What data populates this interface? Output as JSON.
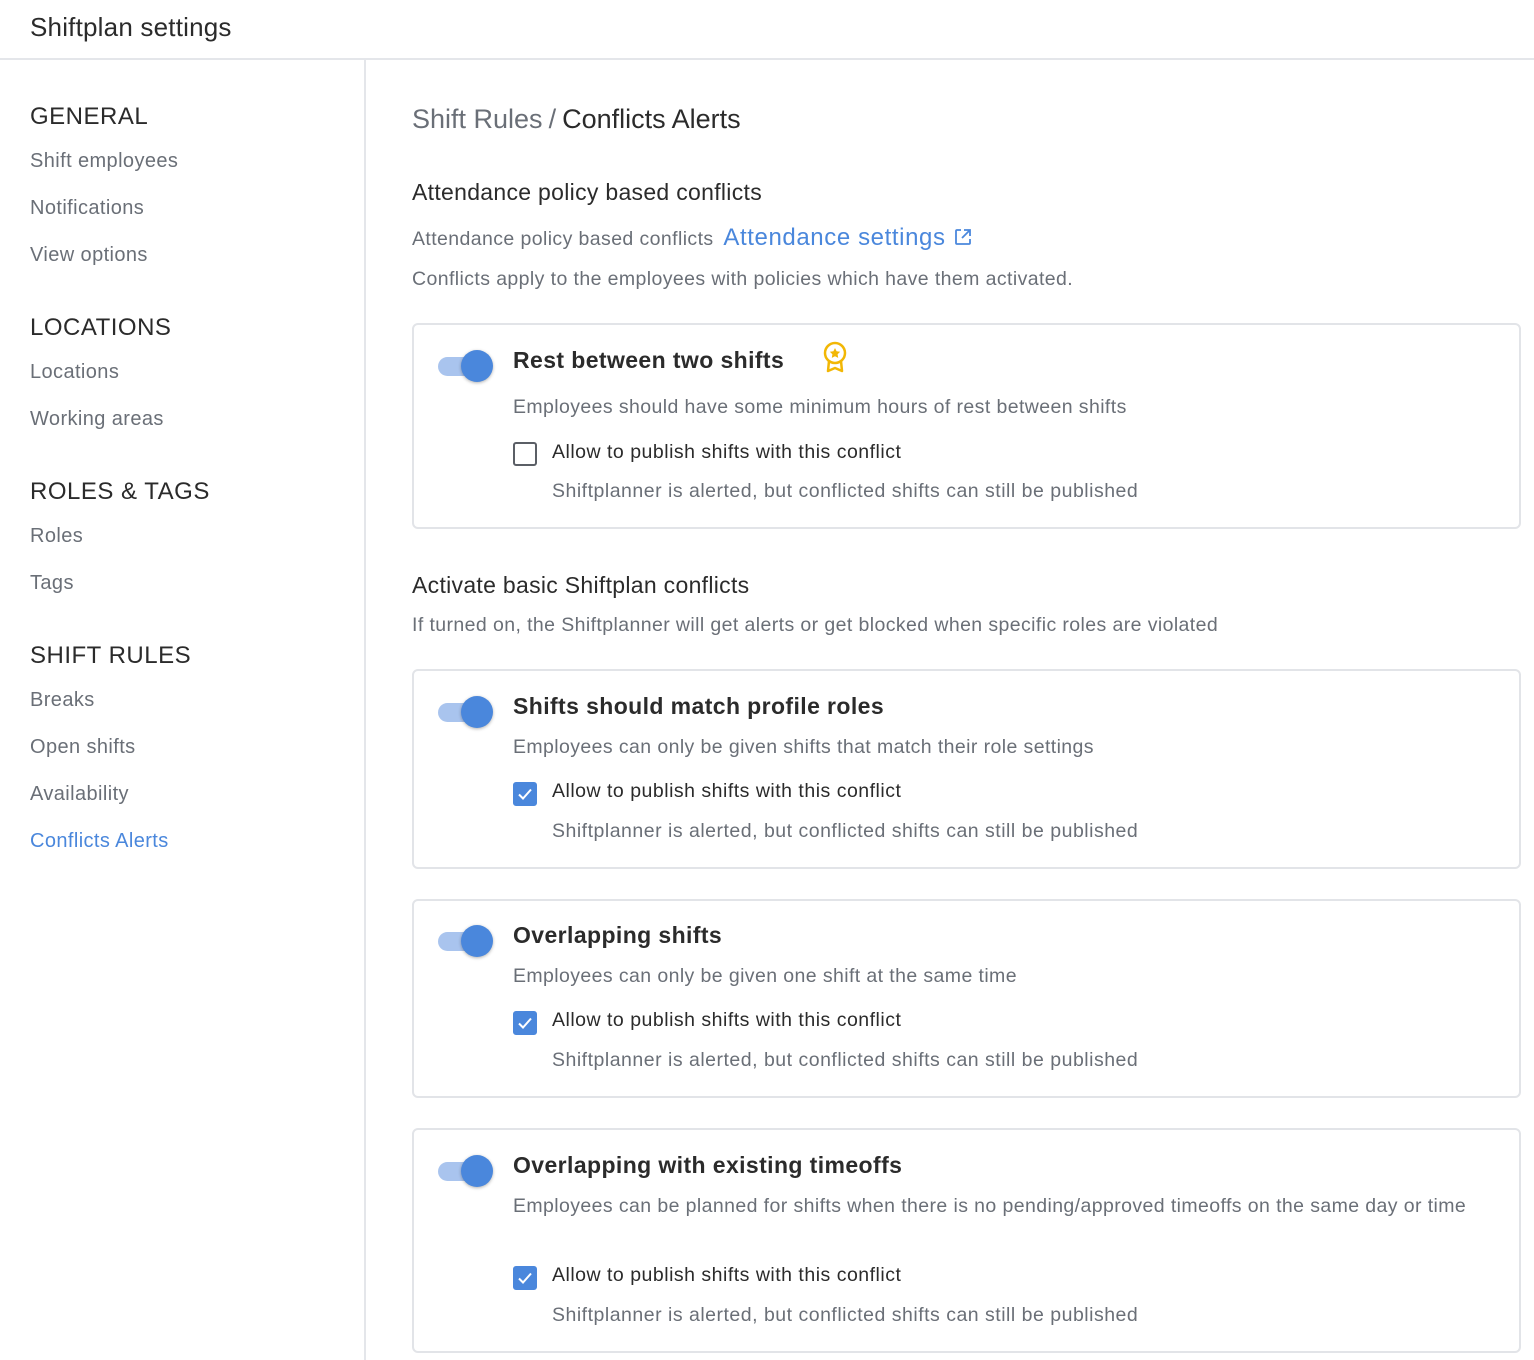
{
  "header": {
    "title": "Shiftplan settings"
  },
  "sidebar": {
    "groups": [
      {
        "heading": "GENERAL",
        "items": [
          "Shift employees",
          "Notifications",
          "View options"
        ]
      },
      {
        "heading": "LOCATIONS",
        "items": [
          "Locations",
          "Working areas"
        ]
      },
      {
        "heading": "ROLES & TAGS",
        "items": [
          "Roles",
          "Tags"
        ]
      },
      {
        "heading": "SHIFT RULES",
        "items": [
          "Breaks",
          "Open shifts",
          "Availability",
          "Conflicts Alerts"
        ]
      }
    ],
    "active_item": "Conflicts Alerts"
  },
  "breadcrumb": {
    "parent": "Shift Rules",
    "separator": "/",
    "current": "Conflicts Alerts"
  },
  "attendance_section": {
    "title": "Attendance policy based conflicts",
    "text": "Attendance policy based conflicts",
    "link_label": "Attendance settings",
    "note": "Conflicts apply to the employees with policies which have them activated."
  },
  "basic_section": {
    "title": "Activate basic Shiftplan conflicts",
    "text": "If turned on, the Shiftplanner will get alerts or get blocked when specific roles are violated"
  },
  "rules": [
    {
      "title": "Rest between two shifts",
      "description": "Employees should have some minimum hours of rest between shifts",
      "enabled": true,
      "premium": true,
      "allow_publish": false,
      "checkbox_label": "Allow to publish shifts with this conflict",
      "checkbox_hint": "Shiftplanner is alerted, but conflicted shifts can still be published"
    },
    {
      "title": "Shifts should match profile roles",
      "description": "Employees can only be given shifts that match their role settings",
      "enabled": true,
      "premium": false,
      "allow_publish": true,
      "checkbox_label": "Allow to publish shifts with this conflict",
      "checkbox_hint": "Shiftplanner is alerted, but conflicted shifts can still be published"
    },
    {
      "title": "Overlapping shifts",
      "description": "Employees can only be given one shift at the same time",
      "enabled": true,
      "premium": false,
      "allow_publish": true,
      "checkbox_label": "Allow to publish shifts with this conflict",
      "checkbox_hint": "Shiftplanner is alerted, but conflicted shifts can still be published"
    },
    {
      "title": "Overlapping with existing timeoffs",
      "description": "Employees can be planned for shifts when there is no pending/approved timeoffs on the same day or time",
      "enabled": true,
      "premium": false,
      "allow_publish": true,
      "checkbox_label": "Allow to publish shifts with this conflict",
      "checkbox_hint": "Shiftplanner is alerted, but conflicted shifts can still be published"
    }
  ],
  "colors": {
    "accent": "#4a87dc",
    "toggle_track": "#a9c4ee",
    "premium_badge": "#f2b705",
    "muted_text": "#6a6f77",
    "border": "#e2e4e8"
  },
  "icons": {
    "external_link": "external-link-icon",
    "premium": "award-badge-icon",
    "check": "checkmark-icon"
  }
}
